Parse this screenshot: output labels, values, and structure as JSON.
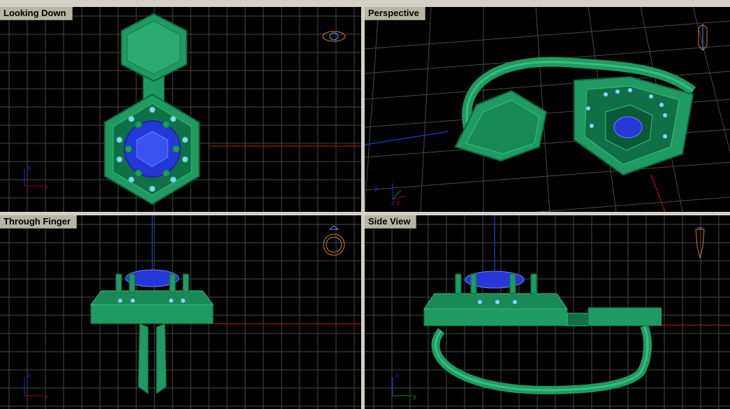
{
  "viewports": {
    "top_left": {
      "title": "Looking Down",
      "axes": [
        "x",
        "y"
      ]
    },
    "top_right": {
      "title": "Perspective",
      "axes": [
        "x",
        "y",
        "z"
      ]
    },
    "bottom_left": {
      "title": "Through Finger",
      "axes": [
        "x",
        "z"
      ]
    },
    "bottom_right": {
      "title": "Side View",
      "axes": [
        "y",
        "z"
      ]
    }
  },
  "colors": {
    "background": "#000000",
    "grid": "#4a4a4a",
    "metal": "#1f9a63",
    "metal_light": "#35c080",
    "metal_dark": "#0d6a40",
    "gem": "#2438d8",
    "gem_light": "#6d82ff",
    "axis_x": "#8a1010",
    "axis_z": "#2030c8",
    "frame": "#d4d0c8"
  },
  "icons": [
    "ring-top-thumbnail-icon",
    "ring-perspective-thumbnail-icon",
    "ring-front-thumbnail-icon",
    "ring-side-thumbnail-icon"
  ]
}
